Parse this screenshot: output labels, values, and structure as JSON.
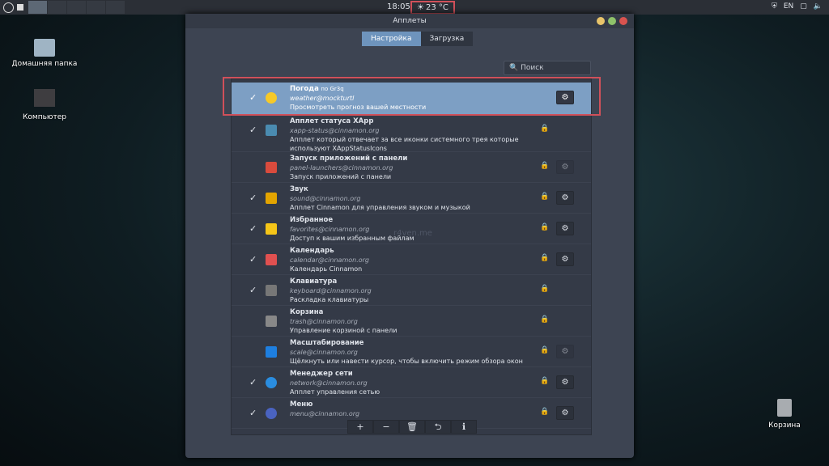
{
  "panel": {
    "clock": "18:05",
    "temperature": "23 °C",
    "lang": "EN"
  },
  "desktop": {
    "home": "Домашняя папка",
    "computer": "Компьютер",
    "trash": "Корзина"
  },
  "window": {
    "title": "Апплеты",
    "tabs": [
      "Настройка",
      "Загрузка"
    ],
    "search_placeholder": "Поиск",
    "watermark": "r4ven.me"
  },
  "applets": [
    {
      "name": "Погода",
      "suffix": "по Gr3q",
      "id": "weather@mockturtl",
      "desc": "Просмотреть прогноз вашей местности",
      "enabled": true,
      "icon": "sun-icon",
      "lock": false,
      "gear": true,
      "selected": true
    },
    {
      "name": "Апплет статуса XApp",
      "id": "xapp-status@cinnamon.org",
      "desc": "Апплет который отвечает за все иконки системного трея которые используют XAppStatusIcons",
      "enabled": true,
      "icon": "tray-icon",
      "lock": true,
      "gear": false
    },
    {
      "name": "Запуск приложений с панели",
      "id": "panel-launchers@cinnamon.org",
      "desc": "Запуск приложений с панели",
      "enabled": false,
      "icon": "launcher-icon",
      "lock": true,
      "gear": "dim"
    },
    {
      "name": "Звук",
      "id": "sound@cinnamon.org",
      "desc": "Апплет Cinnamon для управления звуком и музыкой",
      "enabled": true,
      "icon": "speaker-icon",
      "lock": true,
      "gear": true
    },
    {
      "name": "Избранное",
      "id": "favorites@cinnamon.org",
      "desc": "Доступ к вашим избранным файлам",
      "enabled": true,
      "icon": "star-icon",
      "lock": true,
      "gear": true
    },
    {
      "name": "Календарь",
      "id": "calendar@cinnamon.org",
      "desc": "Календарь Cinnamon",
      "enabled": true,
      "icon": "calendar-icon",
      "lock": true,
      "gear": true
    },
    {
      "name": "Клавиатура",
      "id": "keyboard@cinnamon.org",
      "desc": "Раскладка клавиатуры",
      "enabled": true,
      "icon": "keyboard-icon",
      "lock": true,
      "gear": false
    },
    {
      "name": "Корзина",
      "id": "trash@cinnamon.org",
      "desc": "Управление корзиной с панели",
      "enabled": false,
      "icon": "trash-icon",
      "lock": true,
      "gear": false
    },
    {
      "name": "Масштабирование",
      "id": "scale@cinnamon.org",
      "desc": "Щёлкнуть или навести курсор, чтобы включить режим обзора окон",
      "enabled": false,
      "icon": "scale-icon",
      "lock": true,
      "gear": "dim"
    },
    {
      "name": "Менеджер сети",
      "id": "network@cinnamon.org",
      "desc": "Апплет управления сетью",
      "enabled": true,
      "icon": "network-icon",
      "lock": true,
      "gear": true
    },
    {
      "name": "Меню",
      "id": "menu@cinnamon.org",
      "desc": "",
      "enabled": true,
      "icon": "menu-icon",
      "lock": true,
      "gear": true
    }
  ],
  "toolbar": [
    "+",
    "−",
    "🗑",
    "⮌",
    "ℹ"
  ]
}
